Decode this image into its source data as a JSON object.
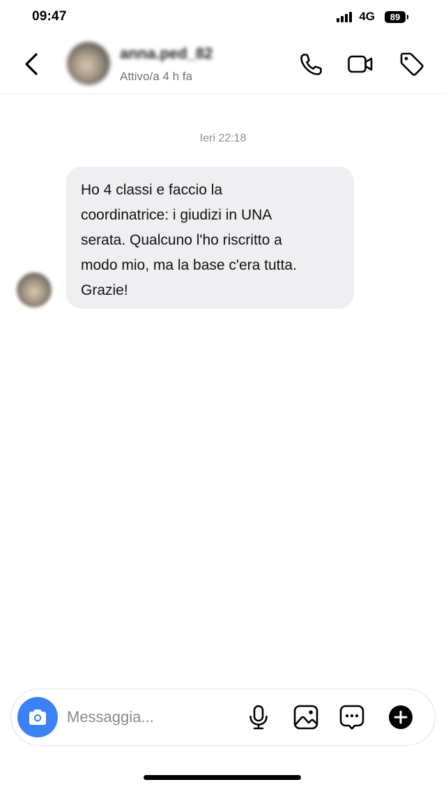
{
  "status_bar": {
    "time": "09:47",
    "network": "4G",
    "battery_level": "89"
  },
  "header": {
    "contact_name": "anna.ped_82",
    "contact_status": "Attivo/a 4 h fa",
    "icons": [
      "back-chevron-icon",
      "phone-icon",
      "video-camera-icon",
      "tag-icon"
    ]
  },
  "conversation": {
    "timestamp": "Ieri 22:18",
    "messages": [
      {
        "text": "Ho 4 classi e faccio la\ncoordinatrice: i giudizi in UNA\nserata. Qualcuno l'ho riscritto a\nmodo mio, ma la base c'era tutta.\nGrazie!"
      }
    ]
  },
  "composer": {
    "placeholder": "Messaggia...",
    "value": "",
    "icons": [
      "camera-icon",
      "microphone-icon",
      "image-icon",
      "sticker-icon",
      "plus-icon"
    ]
  },
  "colors": {
    "accent": "#3b82f6",
    "bubble_background": "#efeff1",
    "secondary_text": "#737373"
  }
}
